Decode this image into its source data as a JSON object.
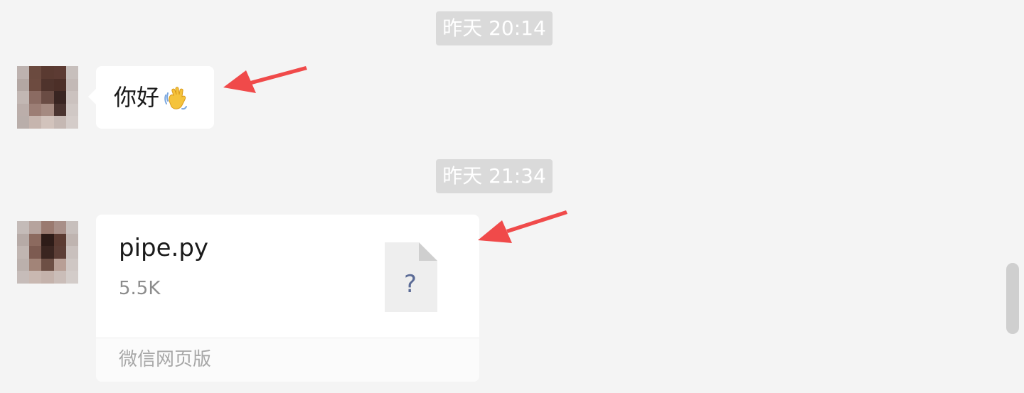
{
  "chat": {
    "timestamps": [
      "昨天 20:14",
      "昨天 21:34"
    ],
    "messages": [
      {
        "type": "text",
        "text": "你好",
        "emoji_icon": "waving-hand-icon"
      },
      {
        "type": "file",
        "file_name": "pipe.py",
        "file_size": "5.5K",
        "file_icon": "unknown-file-icon",
        "file_icon_glyph": "?",
        "source": "微信网页版"
      }
    ]
  },
  "colors": {
    "background": "#f4f4f4",
    "timestamp_bg": "#dadada",
    "bubble": "#ffffff",
    "annotation_arrow": "#f04a4a",
    "file_icon_bg": "#eeeeee",
    "file_icon_glyph": "#5b6b96"
  }
}
